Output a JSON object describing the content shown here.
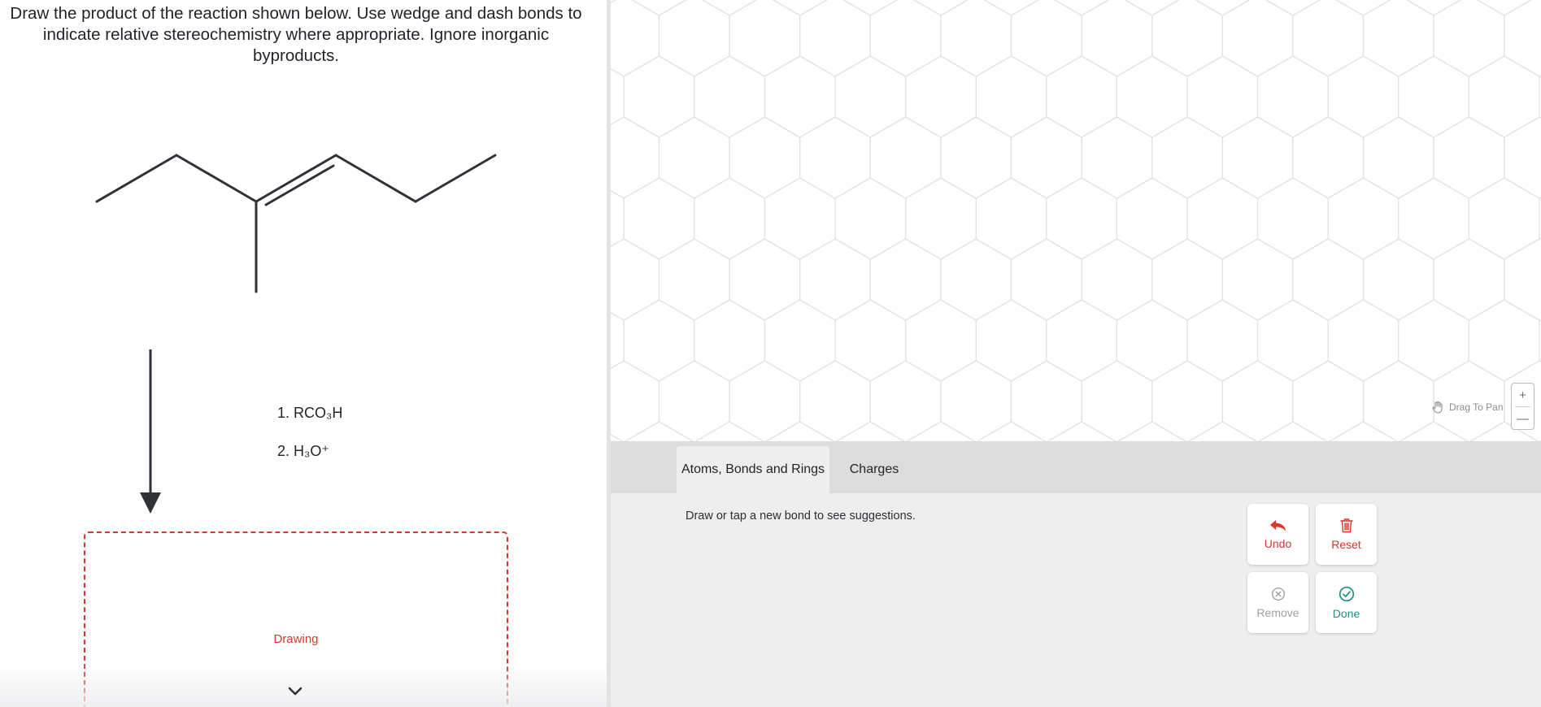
{
  "question": {
    "text": "Draw the product of the reaction shown below. Use wedge and dash bonds to indicate relative stereochemistry where appropriate. Ignore inorganic byproducts."
  },
  "reaction": {
    "reagents": [
      "1. RCO₃H",
      "2. H₃O⁺"
    ]
  },
  "answer_box": {
    "label": "Drawing"
  },
  "editor": {
    "tabs": [
      {
        "label": "Atoms, Bonds and Rings",
        "active": true
      },
      {
        "label": "Charges",
        "active": false
      }
    ],
    "hint": "Draw or tap a new bond to see suggestions.",
    "pan_label": "Drag To Pan",
    "zoom_in": "+",
    "zoom_out": "—",
    "actions": {
      "undo": "Undo",
      "reset": "Reset",
      "remove": "Remove",
      "done": "Done"
    }
  },
  "icons": {
    "undo": "undo-arrow-icon",
    "reset": "trash-icon",
    "remove": "circle-x-icon",
    "done": "circle-check-icon",
    "pan": "hand-icon",
    "expand": "chevron-down-icon"
  },
  "colors": {
    "accent_red": "#d9372b",
    "accent_teal": "#1f8f86",
    "disabled": "#9ea2a6",
    "toolbar_bg": "#dcdcdc",
    "panel_bg": "#eeeeee",
    "grid_line": "#e3e3e3"
  }
}
